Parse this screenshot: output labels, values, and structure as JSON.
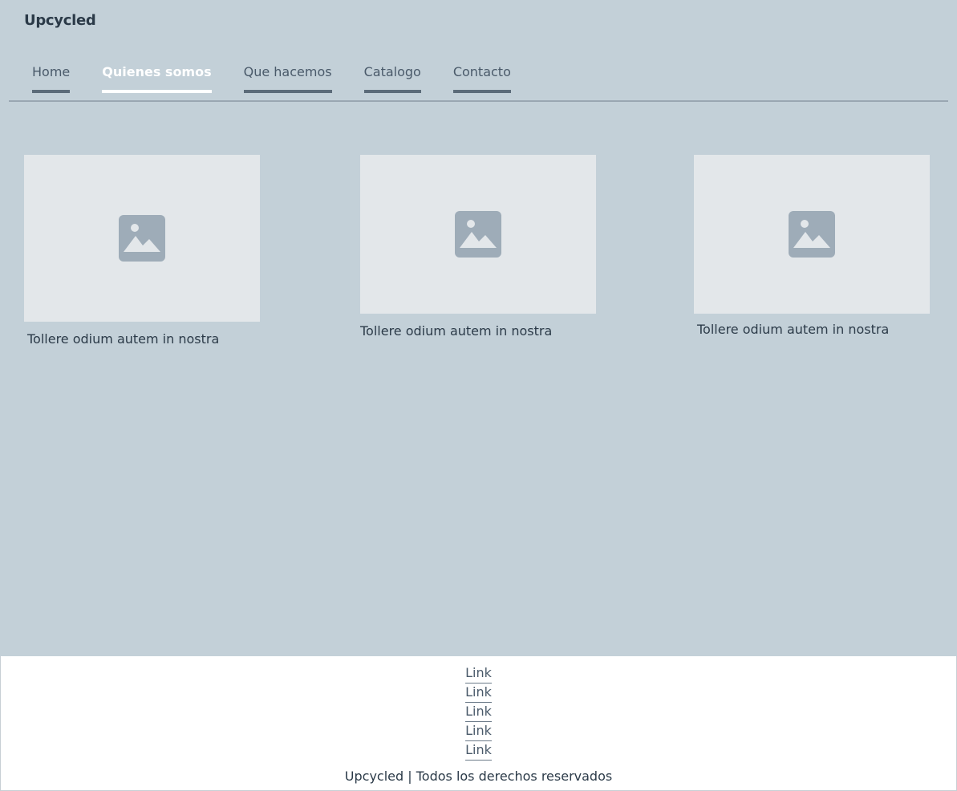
{
  "brand": "Upcycled",
  "nav": {
    "items": [
      {
        "label": "Home",
        "active": false
      },
      {
        "label": "Quienes somos",
        "active": true
      },
      {
        "label": "Que hacemos",
        "active": false
      },
      {
        "label": "Catalogo",
        "active": false
      },
      {
        "label": "Contacto",
        "active": false
      }
    ]
  },
  "cards": [
    {
      "caption": "Tollere odium autem in nostra",
      "image": "image-placeholder-icon"
    },
    {
      "caption": "Tollere odium autem in nostra",
      "image": "image-placeholder-icon"
    },
    {
      "caption": "Tollere odium autem in nostra",
      "image": "image-placeholder-icon"
    }
  ],
  "footer": {
    "links": [
      "Link",
      "Link",
      "Link",
      "Link",
      "Link"
    ],
    "copyright": "Upcycled | Todos los derechos reservados"
  },
  "colors": {
    "background": "#c3d0d8",
    "nav_underline": "#5c6b79",
    "nav_active": "#ffffff",
    "placeholder": "#e3e7ea",
    "placeholder_icon": "#9eacb8",
    "footer_background": "#ffffff"
  }
}
